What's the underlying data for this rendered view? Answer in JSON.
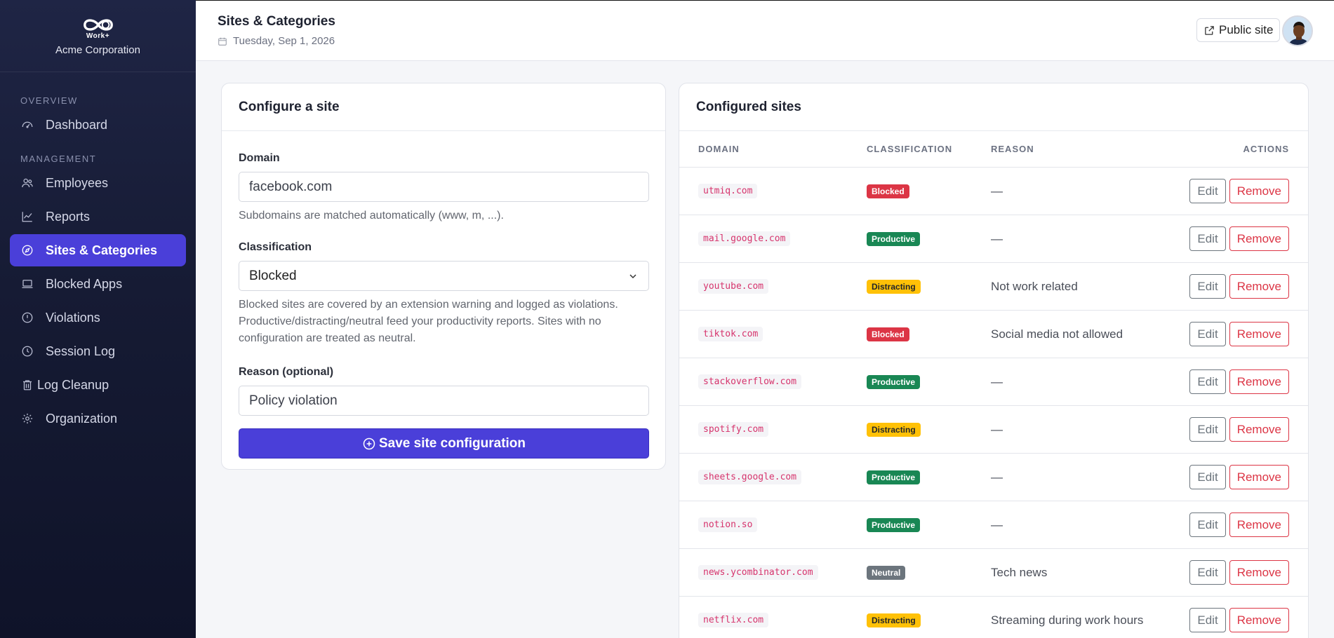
{
  "brand": {
    "logo_text": "Work+",
    "org_name": "Acme Corporation"
  },
  "sidebar": {
    "sections": [
      {
        "label": "OVERVIEW"
      },
      {
        "label": "MANAGEMENT"
      }
    ],
    "items": [
      {
        "label": "Dashboard",
        "icon": "gauge-icon"
      },
      {
        "label": "Employees",
        "icon": "users-icon"
      },
      {
        "label": "Reports",
        "icon": "chart-line-icon"
      },
      {
        "label": "Sites & Categories",
        "icon": "compass-icon",
        "active": true
      },
      {
        "label": "Blocked Apps",
        "icon": "laptop-icon"
      },
      {
        "label": "Violations",
        "icon": "alert-circle-icon"
      },
      {
        "label": "Session Log",
        "icon": "clock-icon"
      },
      {
        "label": "Log Cleanup",
        "icon": "trash-icon"
      },
      {
        "label": "Organization",
        "icon": "gear-icon"
      }
    ]
  },
  "header": {
    "title": "Sites & Categories",
    "date": "Tuesday, Sep 1, 2026",
    "public_site_label": "Public site"
  },
  "form": {
    "title": "Configure a site",
    "domain_label": "Domain",
    "domain_value": "facebook.com",
    "domain_help": "Subdomains are matched automatically (www, m, ...).",
    "classification_label": "Classification",
    "classification_value": "Blocked",
    "classification_help": "Blocked sites are covered by an extension warning and logged as violations. Productive/distracting/neutral feed your productivity reports. Sites with no configuration are treated as neutral.",
    "reason_label": "Reason (optional)",
    "reason_value": "Policy violation",
    "save_label": "Save site configuration"
  },
  "table": {
    "title": "Configured sites",
    "columns": {
      "domain": "DOMAIN",
      "classification": "CLASSIFICATION",
      "reason": "REASON",
      "actions": "ACTIONS"
    },
    "edit_label": "Edit",
    "remove_label": "Remove",
    "rows": [
      {
        "domain": "utmiq.com",
        "classification": "Blocked",
        "reason": "—"
      },
      {
        "domain": "mail.google.com",
        "classification": "Productive",
        "reason": "—"
      },
      {
        "domain": "youtube.com",
        "classification": "Distracting",
        "reason": "Not work related"
      },
      {
        "domain": "tiktok.com",
        "classification": "Blocked",
        "reason": "Social media not allowed"
      },
      {
        "domain": "stackoverflow.com",
        "classification": "Productive",
        "reason": "—"
      },
      {
        "domain": "spotify.com",
        "classification": "Distracting",
        "reason": "—"
      },
      {
        "domain": "sheets.google.com",
        "classification": "Productive",
        "reason": "—"
      },
      {
        "domain": "notion.so",
        "classification": "Productive",
        "reason": "—"
      },
      {
        "domain": "news.ycombinator.com",
        "classification": "Neutral",
        "reason": "Tech news"
      },
      {
        "domain": "netflix.com",
        "classification": "Distracting",
        "reason": "Streaming during work hours"
      }
    ]
  },
  "colors": {
    "accent": "#4a3fd9",
    "blocked": "#dc3545",
    "productive": "#198754",
    "distracting": "#ffc107",
    "neutral": "#6c757d"
  }
}
